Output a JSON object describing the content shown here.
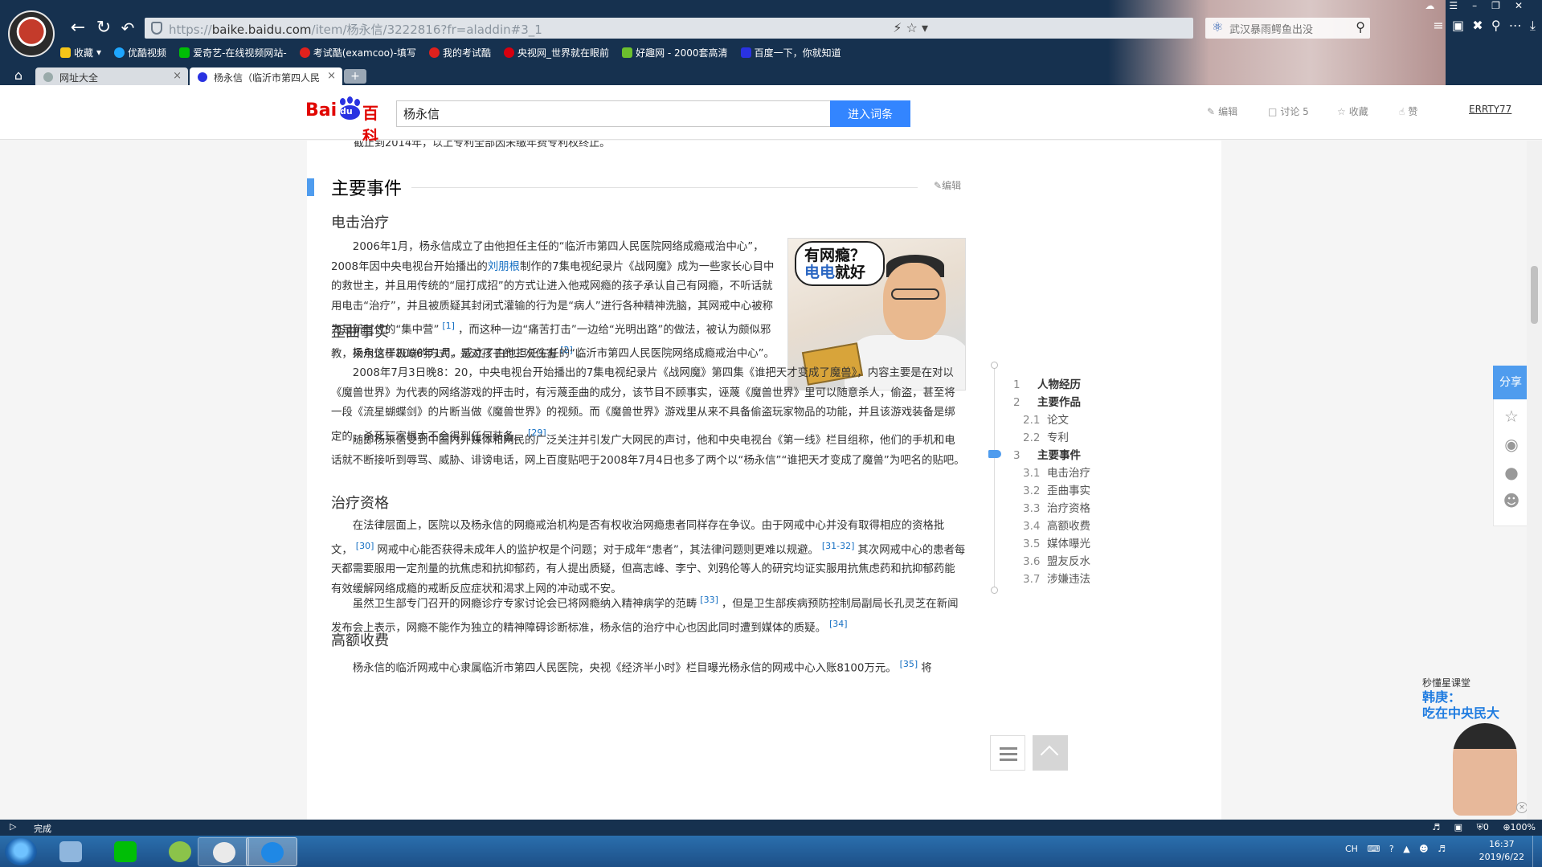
{
  "browser": {
    "address_https": "https://",
    "address_host": "baike.baidu.com",
    "address_path": "/item/杨永信/3222816?fr=aladdin#3_1",
    "search_placeholder": "武汉暴雨鳄鱼出没",
    "bookmarks": [
      {
        "label": "收藏",
        "icon": "star-icon",
        "color": "#f5c518"
      },
      {
        "label": "优酷视频",
        "icon": "youku-icon",
        "color": "#1ea6ff"
      },
      {
        "label": "爱奇艺-在线视频网站-",
        "icon": "iqiyi-icon",
        "color": "#00be06"
      },
      {
        "label": "考试酷(examcoo)-填写",
        "icon": "examcoo-icon",
        "color": "#e0211d"
      },
      {
        "label": "我的考试酷",
        "icon": "examcoo-icon",
        "color": "#e0211d"
      },
      {
        "label": "央视网_世界就在眼前",
        "icon": "cctv-icon",
        "color": "#d7000f"
      },
      {
        "label": "好趣网 - 2000套高清",
        "icon": "haoqu-icon",
        "color": "#6cbf2e"
      },
      {
        "label": "百度一下，你就知道",
        "icon": "baidu-icon",
        "color": "#2932e1"
      }
    ],
    "tabs": [
      {
        "label": "网址大全",
        "active": false
      },
      {
        "label": "杨永信（临沂市第四人民",
        "active": true
      }
    ],
    "new_tab_label": "+",
    "status_text": "完成",
    "status_counter": "0",
    "zoom": "100%"
  },
  "header": {
    "logo_bai": "Bai",
    "logo_du": "du",
    "logo_ke": "百科",
    "search_value": "杨永信",
    "search_button": "进入词条",
    "actions": [
      {
        "label": "编辑",
        "icon": "pencil-icon"
      },
      {
        "label": "讨论 5",
        "icon": "comment-icon"
      },
      {
        "label": "收藏",
        "icon": "star-icon"
      },
      {
        "label": "赞",
        "icon": "thumbs-up-icon"
      }
    ],
    "user": "ERRTY77"
  },
  "article": {
    "cut_text": "截止到2014年，以上专利全部因未缴年费专利权终止。",
    "section_title": "主要事件",
    "section_edit": "编辑",
    "image_bubble_line1": "有网瘾？",
    "image_bubble_line2a": "电电",
    "image_bubble_line2b": "就好",
    "subsections": [
      {
        "title": "电击治疗",
        "paragraphs": [
          {
            "p1": "2006年1月，杨永信成立了由他担任主任的“临沂市第四人民医院网络成瘾戒治中心”，2008年因中央电视台开始播出的",
            "link": "刘朋根",
            "p2": "制作的7集电视纪录片《战网魔》成为一些家长心目中的救世主，并且用传统的“屈打成招”的方式让进入他戒网瘾的孩子承认自己有网瘾，不听话就用电击“治疗”，并且被质疑其封闭式灌输的行为是“病人”进行各种精神洗脑，其网戒中心被称为是新时代的“集中营”",
            "ref1": "[1]",
            "p3": "，而这种一边“痛苦打击”一边给“光明出路”的做法，被认为颇似邪教，采用这样极端的方式，是对孩子的二次伤害",
            "ref2": "[2]",
            "p4": "。"
          }
        ]
      },
      {
        "title": "歪曲事实",
        "paragraphs": [
          {
            "text": "杨永信于2006年1月，成立了由他担任主任的“临沂市第四人民医院网络成瘾戒治中心”。"
          },
          {
            "text": "2008年7月3日晚8：20，中央电视台开始播出的7集电视纪录片《战网魔》第四集《谁把天才变成了魔兽》，内容主要是在对以《魔兽世界》为代表的网络游戏的抨击时，有污蔑歪曲的成分，该节目不顾事实，诬蔑《魔兽世界》里可以随意杀人，偷盗，甚至将一段《流星蝴蝶剑》的片断当做《魔兽世界》的视频。而《魔兽世界》游戏里从来不具备偷盗玩家物品的功能，并且该游戏装备是绑定的，杀死玩家根本不会得到任何装备。",
            "ref": "[29]"
          },
          {
            "text": "随即杨永信受到中国内外媒体和网民的广泛关注并引发广大网民的声讨，他和中央电视台《第一线》栏目组称，他们的手机和电话就不断接听到辱骂、威胁、诽谤电话，网上百度贴吧于2008年7月4日也多了两个以“杨永信”“谁把天才变成了魔兽”为吧名的贴吧。"
          }
        ]
      },
      {
        "title": "治疗资格",
        "paragraphs": [
          {
            "p1": "在法律层面上，医院以及杨永信的网瘾戒治机构是否有权收治网瘾患者同样存在争议。由于网戒中心并没有取得相应的资格批文，",
            "ref1": "[30]",
            "p2": "网戒中心能否获得未成年人的监护权是个问题；对于成年“患者”，其法律问题则更难以规避。",
            "ref2": "[31-32]",
            "p3": "其次网戒中心的患者每天都需要服用一定剂量的抗焦虑和抗抑郁药，有人提出质疑，但高志峰、李宁、刘鸦伦等人的研究均证实服用抗焦虑药和抗抑郁药能有效缓解网络成瘾的戒断反应症状和渴求上网的冲动或不安。"
          },
          {
            "p1": "虽然卫生部专门召开的网瘾诊疗专家讨论会已将网瘾纳入精神病学的范畴",
            "ref1": "[33]",
            "p2": "，但是卫生部疾病预防控制局副局长孔灵芝在新闻发布会上表示，网瘾不能作为独立的精神障碍诊断标准，杨永信的治疗中心也因此同时遭到媒体的质疑。",
            "ref2": "[34]"
          }
        ]
      },
      {
        "title": "高额收费",
        "paragraphs": [
          {
            "p1": "杨永信的临沂网戒中心隶属临沂市第四人民医院，央视《经济半小时》栏目曝光杨永信的网戒中心入账8100万元。",
            "ref": "[35]",
            "p2": "将"
          }
        ]
      }
    ]
  },
  "toc": {
    "items": [
      {
        "num": "1",
        "label": "人物经历",
        "level": 1
      },
      {
        "num": "2",
        "label": "主要作品",
        "level": 1
      },
      {
        "num": "2.1",
        "label": "论文",
        "level": 2
      },
      {
        "num": "2.2",
        "label": "专利",
        "level": 2
      },
      {
        "num": "3",
        "label": "主要事件",
        "level": 1,
        "current": true
      },
      {
        "num": "3.1",
        "label": "电击治疗",
        "level": 2
      },
      {
        "num": "3.2",
        "label": "歪曲事实",
        "level": 2
      },
      {
        "num": "3.3",
        "label": "治疗资格",
        "level": 2
      },
      {
        "num": "3.4",
        "label": "高额收费",
        "level": 2
      },
      {
        "num": "3.5",
        "label": "媒体曝光",
        "level": 2
      },
      {
        "num": "3.6",
        "label": "盟友反水",
        "level": 2
      },
      {
        "num": "3.7",
        "label": "涉嫌违法",
        "level": 2
      }
    ]
  },
  "share": {
    "label": "分享",
    "icons": [
      "star-icon",
      "weibo-icon",
      "wechat-icon",
      "qq-icon"
    ]
  },
  "ad": {
    "small": "秒懂星课堂",
    "title_line1": "韩庚：",
    "title_line2": "吃在中央民大"
  },
  "taskbar": {
    "tray_text": "CH",
    "time": "16:37",
    "date": "2019/6/22"
  }
}
